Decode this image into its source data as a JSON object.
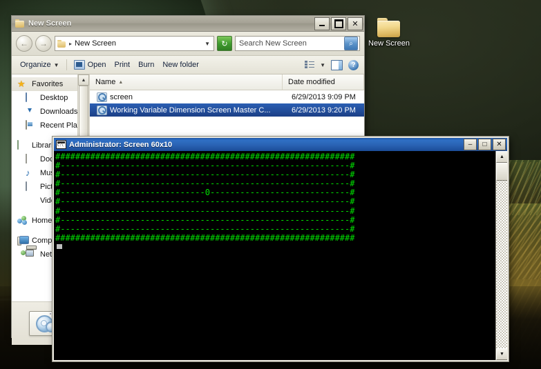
{
  "desktop": {
    "icon": {
      "label": "New Screen",
      "icon": "folder-icon"
    }
  },
  "explorer": {
    "title": "New Screen",
    "title_icon": "folder-icon",
    "window_buttons": {
      "minimize": "–",
      "maximize": "□",
      "close": "✕"
    },
    "nav": {
      "back_icon": "←",
      "forward_icon": "→",
      "breadcrumb_text": "New Screen",
      "breadcrumb_sep": "▸",
      "breadcrumb_chevron": "▼",
      "refresh_icon": "↻",
      "search_placeholder": "Search New Screen",
      "search_value": "",
      "search_icon": "⌕"
    },
    "toolbar": {
      "organize_label": "Organize",
      "organize_caret": "▼",
      "open_label": "Open",
      "print_label": "Print",
      "burn_label": "Burn",
      "new_folder_label": "New folder",
      "view_caret": "▼",
      "help_label": "?"
    },
    "sidebar": {
      "scroll_up": "▲",
      "items": [
        {
          "label": "Favorites",
          "icon": "star-icon",
          "indent": false,
          "selected": true
        },
        {
          "label": "Desktop",
          "icon": "monitor-icon",
          "indent": true,
          "selected": false
        },
        {
          "label": "Downloads",
          "icon": "download-icon",
          "indent": true,
          "selected": false
        },
        {
          "label": "Recent Places",
          "icon": "recent-icon",
          "indent": true,
          "selected": false
        },
        {
          "label": "Libraries",
          "icon": "library-icon",
          "indent": false,
          "selected": false
        },
        {
          "label": "Documents",
          "icon": "document-icon",
          "indent": true,
          "selected": false
        },
        {
          "label": "Music",
          "icon": "music-icon",
          "indent": true,
          "selected": false
        },
        {
          "label": "Pictures",
          "icon": "picture-icon",
          "indent": true,
          "selected": false
        },
        {
          "label": "Videos",
          "icon": "video-icon",
          "indent": true,
          "selected": false
        },
        {
          "label": "Homegroup",
          "icon": "homegroup-icon",
          "indent": false,
          "selected": false
        },
        {
          "label": "Computer",
          "icon": "computer-icon",
          "indent": false,
          "selected": false
        },
        {
          "label": "Network",
          "icon": "network-icon",
          "indent": true,
          "selected": false
        }
      ],
      "details_icon": "application-gear-icon"
    },
    "filelist": {
      "columns": [
        {
          "label": "Name",
          "sorted": true,
          "sort_caret": "▲"
        },
        {
          "label": "Date modified",
          "sorted": false,
          "sort_caret": ""
        }
      ],
      "rows": [
        {
          "name": "screen",
          "date": "6/29/2013 9:09 PM",
          "icon": "application-icon",
          "selected": false
        },
        {
          "name": "Working Variable Dimension Screen Master C...",
          "date": "6/29/2013 9:20 PM",
          "icon": "application-icon",
          "selected": true
        }
      ]
    }
  },
  "console": {
    "title": "Administrator:  Screen 60x10",
    "title_icon": "cmd-icon",
    "window_buttons": {
      "minimize": "–",
      "maximize": "□",
      "close": "✕"
    },
    "colors": {
      "foreground": "#00e000",
      "background": "#000000",
      "titlebar": "#2a63b4"
    },
    "grid": {
      "cols": 60,
      "rows": 10
    },
    "screen_lines": [
      "############################################################",
      "#----------------------------------------------------------#",
      "#----------------------------------------------------------#",
      "#----------------------------------------------------------#",
      "#-----------------------------0----------------------------#",
      "#----------------------------------------------------------#",
      "#----------------------------------------------------------#",
      "#----------------------------------------------------------#",
      "#----------------------------------------------------------#",
      "############################################################"
    ],
    "cursor": "block",
    "scrollbar": {
      "up": "▲",
      "down": "▼"
    }
  }
}
